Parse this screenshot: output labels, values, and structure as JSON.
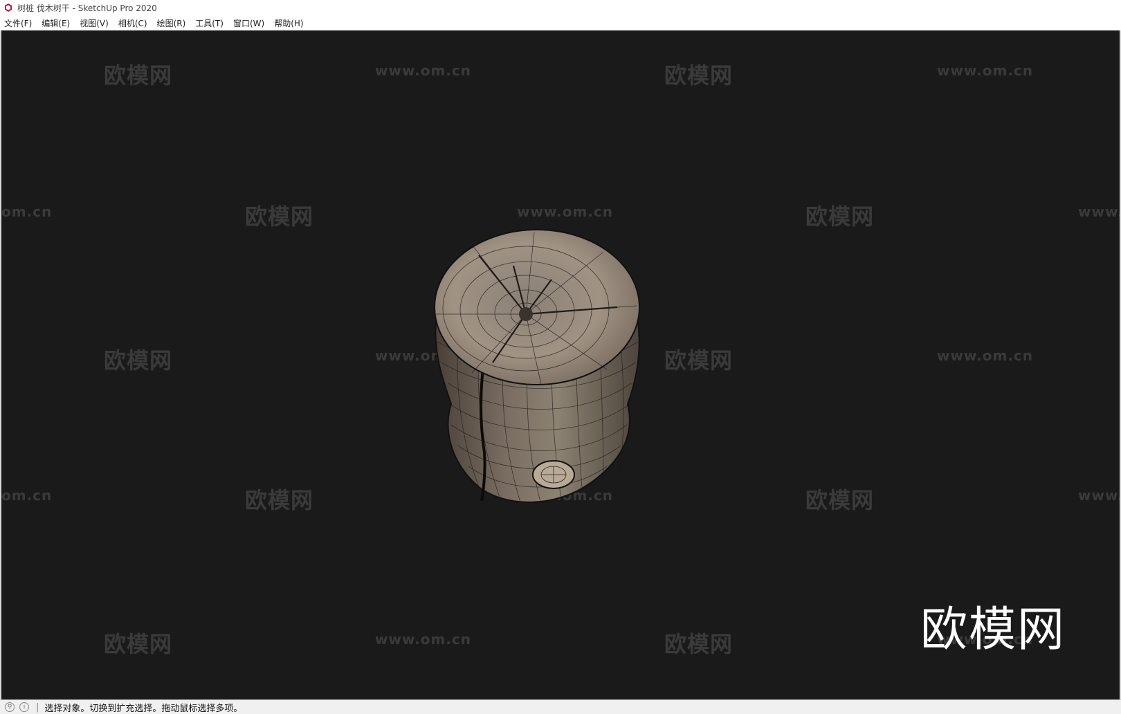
{
  "window": {
    "title": "树桩 伐木树干 - SketchUp Pro 2020"
  },
  "menu": {
    "items": [
      {
        "label": "文件(F)"
      },
      {
        "label": "编辑(E)"
      },
      {
        "label": "视图(V)"
      },
      {
        "label": "相机(C)"
      },
      {
        "label": "绘图(R)"
      },
      {
        "label": "工具(T)"
      },
      {
        "label": "窗口(W)"
      },
      {
        "label": "帮助(H)"
      }
    ]
  },
  "watermarks": {
    "brand": "欧模网",
    "url": "www.om.cn",
    "url_partial": "om.cn",
    "url_partial_right": "www."
  },
  "status": {
    "message": "选择对象。切换到扩充选择。拖动鼠标选择多项。"
  },
  "icons": {
    "app": "sketchup-app-icon",
    "geo": "geo-location-icon",
    "info": "info-icon"
  },
  "colors": {
    "viewport_bg": "#1a1a1a",
    "app_icon": "#c8102e"
  }
}
